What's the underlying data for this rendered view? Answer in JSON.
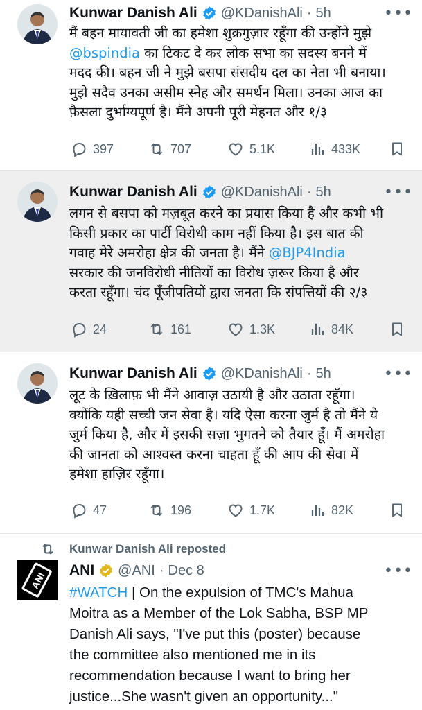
{
  "thread": [
    {
      "author": {
        "name": "Kunwar Danish Ali",
        "handle": "@KDanishAli",
        "time": "5h"
      },
      "text_lines": [
        [
          {
            "t": "मैं बहन मायावती जी का हमेशा शुक्रगुज़ार रहूँगा की उन्होंने मुझे"
          }
        ],
        [
          {
            "t": "@bspindia",
            "link": true
          },
          {
            "t": " का टिकट दे कर लोक सभा का सदस्य बनने में"
          }
        ],
        [
          {
            "t": "मदद की। बहन जी ने मुझे बसपा संसदीय दल का नेता भी बनाया।"
          }
        ],
        [
          {
            "t": "मुझे सदैव उनका असीम स्नेह और समर्थन मिला। उनका आज का"
          }
        ],
        [
          {
            "t": "फ़ैसला दुर्भाग्यपूर्ण है। मैंने अपनी पूरी मेहनत और १/३"
          }
        ]
      ],
      "stats": {
        "replies": "397",
        "reposts": "707",
        "likes": "5.1K",
        "views": "433K"
      }
    },
    {
      "author": {
        "name": "Kunwar Danish Ali",
        "handle": "@KDanishAli",
        "time": "5h"
      },
      "text_lines": [
        [
          {
            "t": "लगन से बसपा को मज़बूत करने का प्रयास किया है और कभी भी"
          }
        ],
        [
          {
            "t": "किसी प्रकार का पार्टी विरोधी काम नहीं किया है। इस बात की"
          }
        ],
        [
          {
            "t": "गवाह मेरे अमरोहा क्षेत्र की जनता है।  मैंने "
          },
          {
            "t": "@BJP4India",
            "link": true
          }
        ],
        [
          {
            "t": "सरकार की जनविरोधी नीतियों का विरोध ज़रूर किया है और"
          }
        ],
        [
          {
            "t": "करता रहूँगा। चंद पूँजीपतियों द्वारा जनता कि संपत्तियों की २/३"
          }
        ]
      ],
      "stats": {
        "replies": "24",
        "reposts": "161",
        "likes": "1.3K",
        "views": "84K"
      }
    },
    {
      "author": {
        "name": "Kunwar Danish Ali",
        "handle": "@KDanishAli",
        "time": "5h"
      },
      "text_lines": [
        [
          {
            "t": "लूट के ख़िलाफ़ भी मैंने आवाज़ उठायी है और उठाता रहूँगा।"
          }
        ],
        [
          {
            "t": "क्योंकि यही सच्ची जन सेवा है। यदि ऐसा करना जुर्म है तो मैंने ये"
          }
        ],
        [
          {
            "t": "जुर्म किया है, और में इसकी सज़ा भुगतने को तैयार हूँ। मैं अमरोहा"
          }
        ],
        [
          {
            "t": "की जानता को आश्वस्त करना चाहता हूँ की आप की सेवा में"
          }
        ],
        [
          {
            "t": "हमेशा हाज़िर रहूँगा।"
          }
        ]
      ],
      "stats": {
        "replies": "47",
        "reposts": "196",
        "likes": "1.7K",
        "views": "82K"
      }
    }
  ],
  "repost": {
    "label": "Kunwar Danish Ali reposted",
    "author": {
      "name": "ANI",
      "handle": "@ANI",
      "time": "Dec 8",
      "avatar_text": "ANI"
    },
    "text_lines": [
      [
        {
          "t": "#WATCH",
          "link": true
        },
        {
          "t": " | On the expulsion of TMC's Mahua"
        }
      ],
      [
        {
          "t": "Moitra as a Member of the Lok Sabha, BSP MP"
        }
      ],
      [
        {
          "t": "Danish Ali says, \"I've put this (poster) because"
        }
      ],
      [
        {
          "t": "the committee also mentioned me in its"
        }
      ],
      [
        {
          "t": "recommendation because I want to bring her"
        }
      ],
      [
        {
          "t": "justice...She wasn't given an opportunity...\""
        }
      ]
    ]
  },
  "ui": {
    "separator_dot": "·",
    "more_glyph": "•••"
  },
  "colors": {
    "link": "#1d9bf0",
    "secondary_text": "#536471",
    "verified_blue": "#1d9bf0",
    "verified_gold": "#e2b719",
    "highlight_bg": "#efefef"
  },
  "icons": [
    "reply-icon",
    "repost-icon",
    "like-icon",
    "views-icon",
    "bookmark-icon",
    "verified-badge-icon",
    "more-icon"
  ]
}
